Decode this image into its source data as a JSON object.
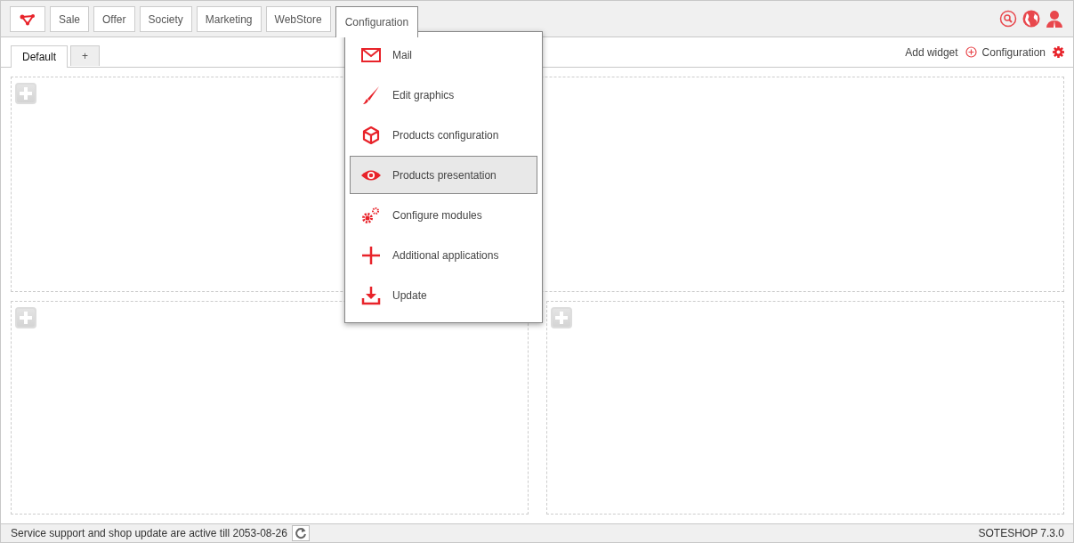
{
  "nav": [
    {
      "label": "Sale",
      "selected": false
    },
    {
      "label": "Offer",
      "selected": false
    },
    {
      "label": "Society",
      "selected": false
    },
    {
      "label": "Marketing",
      "selected": false
    },
    {
      "label": "WebStore",
      "selected": false
    },
    {
      "label": "Configuration",
      "selected": true
    }
  ],
  "menu": [
    {
      "label": "Mail",
      "selected": false
    },
    {
      "label": "Edit graphics",
      "selected": false
    },
    {
      "label": "Products configuration",
      "selected": false
    },
    {
      "label": "Products presentation",
      "selected": true
    },
    {
      "label": "Configure modules",
      "selected": false
    },
    {
      "label": "Additional applications",
      "selected": false
    },
    {
      "label": "Update",
      "selected": false
    }
  ],
  "tabs": [
    {
      "label": "Default",
      "selected": true
    },
    {
      "label": "+",
      "selected": false
    }
  ],
  "toolbar": {
    "add_widget": "Add widget",
    "configuration": "Configuration"
  },
  "status_bar": {
    "message": "Service support and shop update are active till 2053-08-26",
    "version": "SOTESHOP 7.3.0"
  }
}
